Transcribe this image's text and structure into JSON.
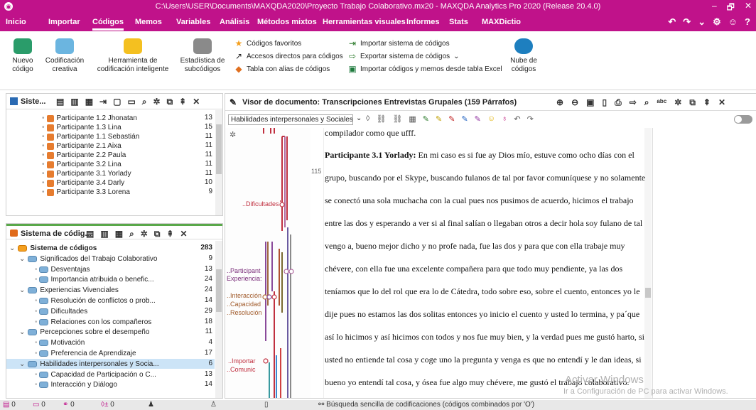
{
  "window": {
    "title": "C:\\Users\\USER\\Documents\\MAXQDA2020\\Proyecto Trabajo Colaborativo.mx20 - MAXQDA Analytics Pro 2020 (Release 20.4.0)",
    "min": "–",
    "max": "🗗",
    "close": "✕"
  },
  "menu": {
    "items": [
      "Inicio",
      "Importar",
      "Códigos",
      "Memos",
      "Variables",
      "Análisis",
      "Métodos mixtos",
      "Herramientas visuales",
      "Informes",
      "Stats",
      "MAXDictio"
    ],
    "active": "Códigos",
    "right": [
      "↶",
      "↷",
      "⌄",
      "⚙",
      "☺",
      "?"
    ]
  },
  "ribbon": {
    "nuevo_codigo": "Nuevo\ncódigo",
    "codificacion_creativa": "Codificación\ncreativa",
    "herramienta": "Herramienta de\ncodificación inteligente",
    "estadistica": "Estadística de\nsubcódigos",
    "codigos_favoritos": "Códigos favoritos",
    "accesos_directos": "Accesos directos para códigos",
    "tabla_alias": "Tabla con alias de códigos",
    "importar_sistema": "Importar sistema de códigos",
    "exportar_sistema": "Exportar sistema de códigos",
    "importar_excel": "Importar códigos y memos desde tabla Excel",
    "nube": "Nube de\ncódigos"
  },
  "doc_system": {
    "title": "Siste...",
    "items": [
      {
        "label": "Participante 1.2 Jhonatan",
        "count": "13"
      },
      {
        "label": "Participante 1.3 Lina",
        "count": "15"
      },
      {
        "label": "Participante 1.1 Sebastián",
        "count": "11"
      },
      {
        "label": "Participante 2.1 Aixa",
        "count": "11"
      },
      {
        "label": "Participante 2.2 Paula",
        "count": "11"
      },
      {
        "label": "Participante 3.2 Lina",
        "count": "11"
      },
      {
        "label": "Participante 3.1 Yorlady",
        "count": "11"
      },
      {
        "label": "Participante 3.4 Darly",
        "count": "10"
      },
      {
        "label": "Participante 3.3 Lorena",
        "count": "9"
      }
    ]
  },
  "code_system": {
    "title": "Sistema de códig...",
    "items": [
      {
        "label": "Sistema de códigos",
        "count": "283",
        "level": 0,
        "bold": true
      },
      {
        "label": "Significados del Trabajo Colaborativo",
        "count": "9",
        "level": 1
      },
      {
        "label": "Desventajas",
        "count": "13",
        "level": 2
      },
      {
        "label": "Importancia atribuida o benefic...",
        "count": "24",
        "level": 2
      },
      {
        "label": "Experiencias Vivenciales",
        "count": "24",
        "level": 1
      },
      {
        "label": "Resolución de conflictos o prob...",
        "count": "14",
        "level": 2
      },
      {
        "label": "Dificultades",
        "count": "29",
        "level": 2
      },
      {
        "label": "Relaciones con los compañeros",
        "count": "18",
        "level": 2
      },
      {
        "label": "Percepciones sobre el desempeño",
        "count": "11",
        "level": 1
      },
      {
        "label": "Motivación",
        "count": "4",
        "level": 2
      },
      {
        "label": "Preferencia de Aprendizaje",
        "count": "17",
        "level": 2
      },
      {
        "label": "Habilidades interpersonales y Socia...",
        "count": "6",
        "level": 1,
        "selected": true
      },
      {
        "label": "Capacidad de Participación o C...",
        "count": "13",
        "level": 2
      },
      {
        "label": "Interacción y Diálogo",
        "count": "14",
        "level": 2
      }
    ]
  },
  "viewer": {
    "title": "Visor de documento: Transcripciones Entrevistas Grupales (159 Párrafos)",
    "code_select": "Habilidades interpersonales y Sociales",
    "paragraph_num": "115",
    "top_line": "compilador como que ufff.",
    "speaker": "Participante 3.1 Yorlady:",
    "lines": [
      " En mi caso es si fue ay Dios mío, estuve como ocho días con el",
      "grupo, buscando por el Skype, buscando fulanos de tal por favor comuníquese y no solamente",
      "se conectó una sola muchacha con la cual pues nos pusimos de acuerdo, hicimos el trabajo",
      "entre las dos y esperando a ver si al final salían o llegaban otros a decir hola soy fulano de tal",
      "vengo a, bueno mejor dicho y no profe nada, fue las dos y para que con ella trabaje muy",
      "chévere, con ella fue una excelente compañera para que todo muy pendiente, ya las dos",
      "teníamos que lo del rol que era lo de Cátedra, todo sobre eso, sobre el cuento, entonces yo le",
      "dije pues no estamos las dos solitas entonces yo inicio el cuento y usted lo termina, y pa´que",
      "así lo hicimos y así hicimos con todos y nos fue muy bien, y la verdad pues me gustó harto, si",
      "usted no entiende tal cosa y coge uno la pregunta y venga es que no entendí y le dan ideas, si",
      "bueno yo entendí tal cosa, y ósea fue algo muy chévere, me gustó el trabajo colaborativo."
    ],
    "code_labels": [
      "..Dificultades",
      "..Participant",
      "Experiencia:",
      "..Interacción",
      "..Capacidad",
      "..Resolución",
      "..Importar",
      "..Comunic"
    ]
  },
  "watermark": {
    "line1": "Activar Windows",
    "line2": "Ir a Configuración de PC para activar Windows."
  },
  "status": {
    "items": [
      "0",
      "0",
      "0",
      "0"
    ],
    "search": "Búsqueda sencilla de codificaciones (códigos combinados por 'O')"
  },
  "colors": {
    "brand": "#c0128a",
    "selected": "#cce4f7"
  }
}
